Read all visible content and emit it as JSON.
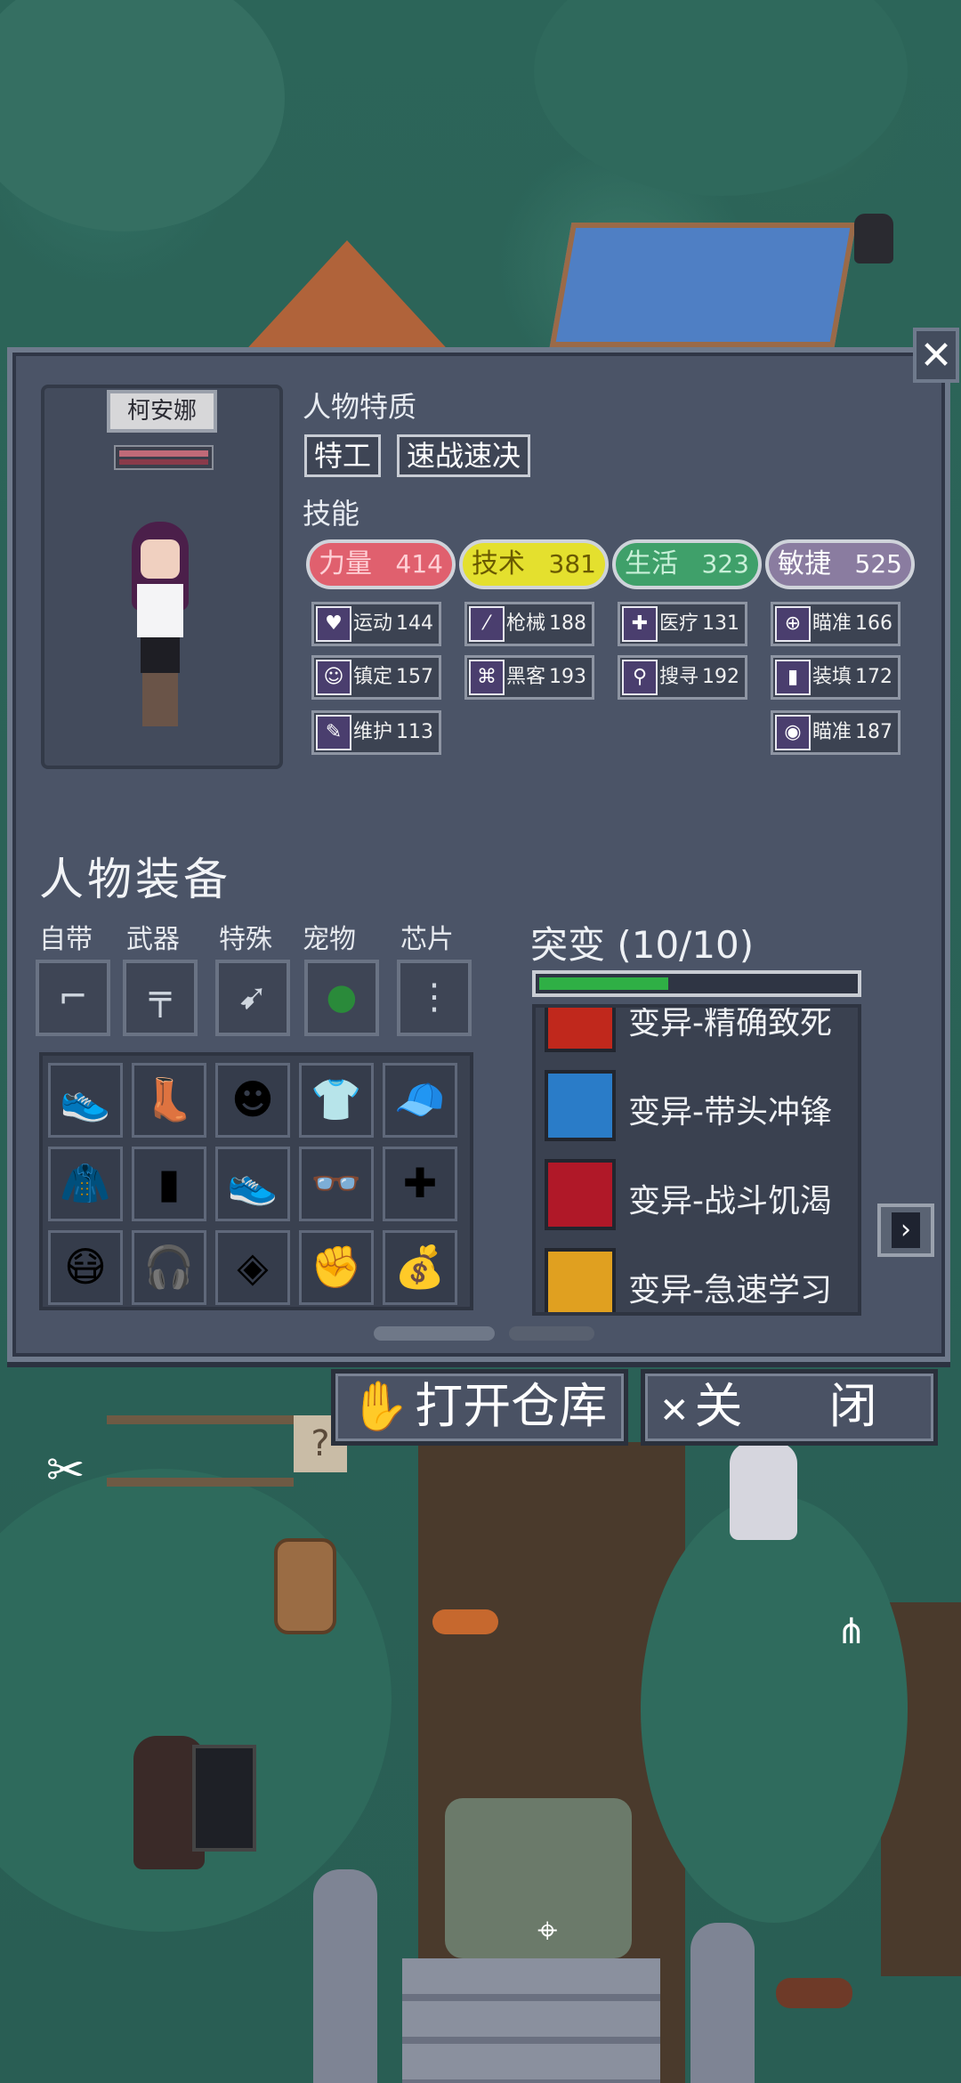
{
  "character": {
    "name": "柯安娜",
    "traits_title": "人物特质",
    "traits": [
      "特工",
      "速战速决"
    ],
    "skills_title": "技能"
  },
  "stats": [
    {
      "label": "力量",
      "value": "414",
      "color": "#e0606e",
      "text_color": "#ffd0d6"
    },
    {
      "label": "技术",
      "value": "381",
      "color": "#e4e02e",
      "text_color": "#6a5a00"
    },
    {
      "label": "生活",
      "value": "323",
      "color": "#3fa06a",
      "text_color": "#c8f0d8"
    },
    {
      "label": "敏捷",
      "value": "525",
      "color": "#8a7ca0",
      "text_color": "#ffffff"
    }
  ],
  "skills": [
    {
      "icon": "heart-icon",
      "glyph": "♥",
      "label": "运动",
      "value": "144"
    },
    {
      "icon": "gun-icon",
      "glyph": "⁄",
      "label": "枪械",
      "value": "188"
    },
    {
      "icon": "medkit-icon",
      "glyph": "✚",
      "label": "医疗",
      "value": "131"
    },
    {
      "icon": "crosshair-icon",
      "glyph": "⊕",
      "label": "瞄准",
      "value": "166"
    },
    {
      "icon": "mask-icon",
      "glyph": "☺",
      "label": "镇定",
      "value": "157"
    },
    {
      "icon": "hacker-icon",
      "glyph": "⌘",
      "label": "黑客",
      "value": "193"
    },
    {
      "icon": "magnifier-icon",
      "glyph": "⚲",
      "label": "搜寻",
      "value": "192"
    },
    {
      "icon": "magazine-icon",
      "glyph": "▮",
      "label": "装填",
      "value": "172"
    },
    {
      "icon": "wrench-icon",
      "glyph": "✎",
      "label": "维护",
      "value": "113"
    },
    {
      "icon": "eye-icon",
      "glyph": "◉",
      "label": "瞄准",
      "value": "187"
    }
  ],
  "equipment": {
    "title": "人物装备",
    "slot_labels": [
      "自带",
      "武器",
      "特殊",
      "宠物",
      "芯片"
    ],
    "slots": [
      {
        "name": "revolver-icon",
        "glyph": "⌐"
      },
      {
        "name": "rifle-icon",
        "glyph": "╤"
      },
      {
        "name": "kunai-icon",
        "glyph": "➹"
      },
      {
        "name": "green-pet-icon",
        "glyph": "●"
      },
      {
        "name": "chip-icon",
        "glyph": "⋮"
      }
    ],
    "inventory": [
      {
        "name": "sneaker-icon",
        "glyph": "👟"
      },
      {
        "name": "boot-icon",
        "glyph": "👢"
      },
      {
        "name": "hockey-mask-icon",
        "glyph": "☻"
      },
      {
        "name": "tshirt-icon",
        "glyph": "👕"
      },
      {
        "name": "cap-icon",
        "glyph": "🧢"
      },
      {
        "name": "suit-icon",
        "glyph": "🧥"
      },
      {
        "name": "blue-boots-icon",
        "glyph": "▮"
      },
      {
        "name": "running-shoe-icon",
        "glyph": "👟"
      },
      {
        "name": "glasses-icon",
        "glyph": "👓"
      },
      {
        "name": "first-aid-kit-icon",
        "glyph": "✚"
      },
      {
        "name": "face-mask-icon",
        "glyph": "😷"
      },
      {
        "name": "headphones-icon",
        "glyph": "🎧"
      },
      {
        "name": "armor-vest-icon",
        "glyph": "◈"
      },
      {
        "name": "gauntlet-icon",
        "glyph": "✊"
      },
      {
        "name": "sack-icon",
        "glyph": "💰"
      }
    ]
  },
  "mutations": {
    "title": "突变 (10/10)",
    "progress": 0.4,
    "items": [
      {
        "label": "变异-精确致死",
        "icon": "red-slash-icon",
        "color": "#c0281c"
      },
      {
        "label": "变异-带头冲锋",
        "icon": "charge-figure-icon",
        "color": "#2a7cc8"
      },
      {
        "label": "变异-战斗饥渴",
        "icon": "fist-icon",
        "color": "#b01828"
      },
      {
        "label": "变异-急速学习",
        "icon": "burst-icon",
        "color": "#e0a020"
      }
    ]
  },
  "buttons": {
    "open_storage": "打开仓库",
    "close": "关 闭"
  }
}
